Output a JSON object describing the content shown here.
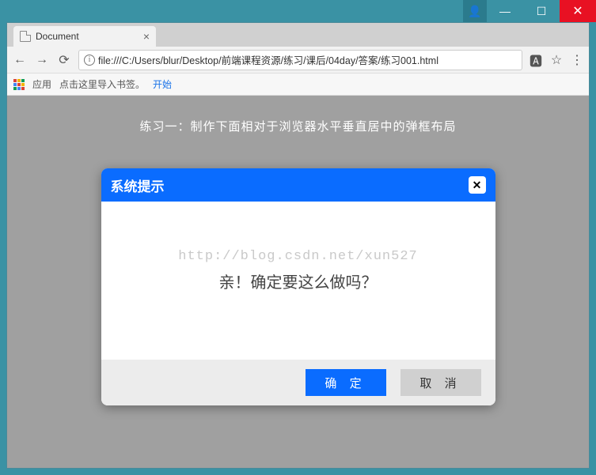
{
  "window": {
    "min": "—",
    "max": "☐",
    "close": "✕",
    "user": "👤"
  },
  "tab": {
    "title": "Document",
    "close": "×"
  },
  "toolbar": {
    "back": "←",
    "forward": "→",
    "reload": "⟳",
    "url_prefix": "ⓘ",
    "url": "file:///C:/Users/blur/Desktop/前端课程资源/练习/课后/04day/答案/练习001.html",
    "translate": "🅰",
    "star": "☆",
    "menu": "⋮"
  },
  "bookmarks": {
    "apps": "应用",
    "hint": "点击这里导入书签。",
    "start": "开始"
  },
  "page": {
    "heading": "练习一：制作下面相对于浏览器水平垂直居中的弹框布局",
    "watermark": "http://blog.csdn.net/xun527"
  },
  "dialog": {
    "title": "系统提示",
    "close": "✕",
    "message": "亲！确定要这么做吗？",
    "ok": "确 定",
    "cancel": "取 消"
  }
}
